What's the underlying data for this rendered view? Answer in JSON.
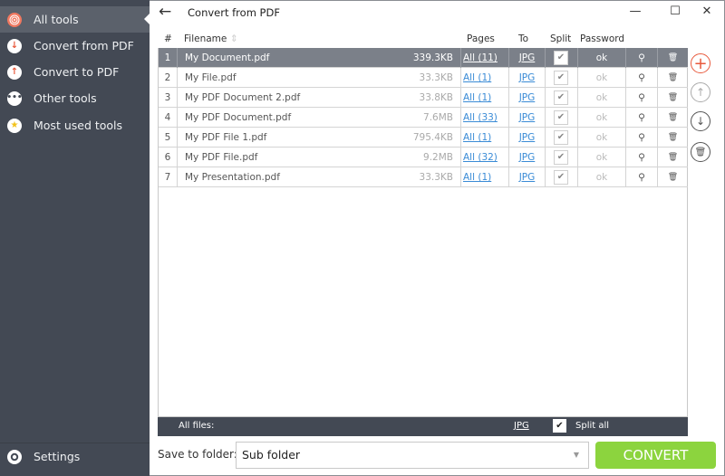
{
  "sidebar": {
    "items": [
      {
        "label": "All tools",
        "icon": "target-icon",
        "active": true
      },
      {
        "label": "Convert from PDF",
        "icon": "arrow-down-icon"
      },
      {
        "label": "Convert to PDF",
        "icon": "arrow-up-icon"
      },
      {
        "label": "Other tools",
        "icon": "ellipsis-icon"
      },
      {
        "label": "Most used tools",
        "icon": "star-icon"
      }
    ],
    "settings_label": "Settings"
  },
  "window": {
    "title": "Convert from PDF",
    "back_glyph": "←",
    "minimize_glyph": "—",
    "maximize_glyph": "☐",
    "close_glyph": "✕"
  },
  "table": {
    "headers": {
      "num": "#",
      "filename": "Filename",
      "sort_glyph": "⇕",
      "pages": "Pages",
      "to": "To",
      "split": "Split",
      "password": "Password"
    },
    "rows": [
      {
        "num": "1",
        "name": "My Document.pdf",
        "size": "339.3KB",
        "pages": "All (11)",
        "to": "JPG",
        "split": true,
        "password": "ok",
        "selected": true
      },
      {
        "num": "2",
        "name": "My File.pdf",
        "size": "33.3KB",
        "pages": "All (1)",
        "to": "JPG",
        "split": true,
        "password": "ok"
      },
      {
        "num": "3",
        "name": "My PDF Document 2.pdf",
        "size": "33.8KB",
        "pages": "All (1)",
        "to": "JPG",
        "split": true,
        "password": "ok"
      },
      {
        "num": "4",
        "name": "My PDF Document.pdf",
        "size": "7.6MB",
        "pages": "All (33)",
        "to": "JPG",
        "split": true,
        "password": "ok"
      },
      {
        "num": "5",
        "name": "My PDF File 1.pdf",
        "size": "795.4KB",
        "pages": "All (1)",
        "to": "JPG",
        "split": true,
        "password": "ok"
      },
      {
        "num": "6",
        "name": "My PDF File.pdf",
        "size": "9.2MB",
        "pages": "All (32)",
        "to": "JPG",
        "split": true,
        "password": "ok"
      },
      {
        "num": "7",
        "name": "My Presentation.pdf",
        "size": "33.3KB",
        "pages": "All (1)",
        "to": "JPG",
        "split": true,
        "password": "ok"
      }
    ],
    "check_glyph": "✔",
    "preview_glyph": "⚲",
    "delete_glyph": "🗑"
  },
  "footer": {
    "all_files_label": "All files:",
    "format": "JPG",
    "split_all_label": "Split all",
    "split_all_checked": true
  },
  "side_buttons": {
    "add_glyph": "+",
    "up_glyph": "↑",
    "down_glyph": "↓",
    "delete_glyph": "🗑"
  },
  "bottom": {
    "save_label": "Save to folder:",
    "folder_value": "Sub folder",
    "convert_label": "CONVERT"
  },
  "colors": {
    "sidebar_bg": "#434954",
    "selected_row": "#7b8089",
    "convert_green": "#8cd43e",
    "add_red": "#e8593c",
    "link_blue": "#3a8bd6"
  }
}
